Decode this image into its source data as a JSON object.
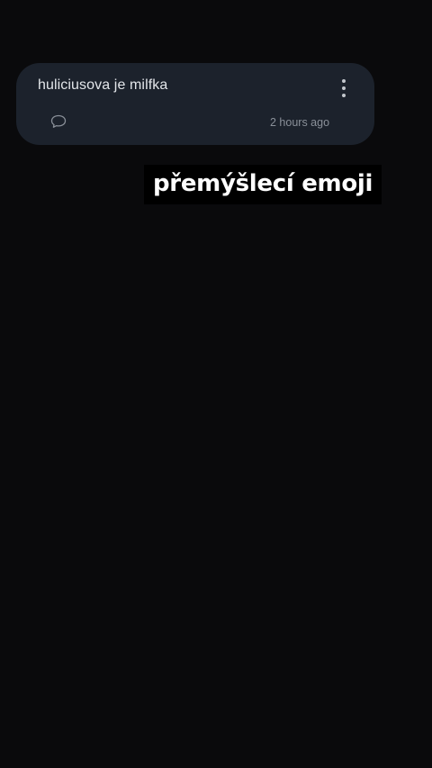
{
  "post": {
    "text": "huliciusova je milfka",
    "timestamp": "2 hours ago",
    "comment_icon": "speech-bubble-icon",
    "menu_icon": "vertical-dots-icon"
  },
  "caption": {
    "text": "přemýšlecí emoji"
  }
}
